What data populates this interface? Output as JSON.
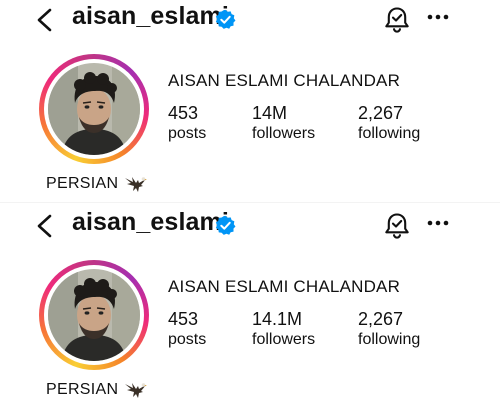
{
  "profiles": [
    {
      "username": "aisan_eslami",
      "full_name": "AISAN ESLAMI CHALANDAR",
      "posts_count": "453",
      "posts_label": "posts",
      "followers_count": "14M",
      "followers_label": "followers",
      "following_count": "2,267",
      "following_label": "following",
      "bio": "PERSIAN"
    },
    {
      "username": "aisan_eslami",
      "full_name": "AISAN ESLAMI CHALANDAR",
      "posts_count": "453",
      "posts_label": "posts",
      "followers_count": "14.1M",
      "followers_label": "followers",
      "following_count": "2,267",
      "following_label": "following",
      "bio": "PERSIAN"
    }
  ],
  "icons": {
    "back": "chevron-left-icon",
    "verified": "verified-badge-icon",
    "notifications": "bell-check-icon",
    "more": "more-horizontal-icon",
    "bio_emoji": "eagle-icon"
  },
  "colors": {
    "verified_blue": "#0095f6",
    "ring_gradient": [
      "#f9ce34",
      "#f77737",
      "#ee2a7b",
      "#c13584"
    ]
  }
}
